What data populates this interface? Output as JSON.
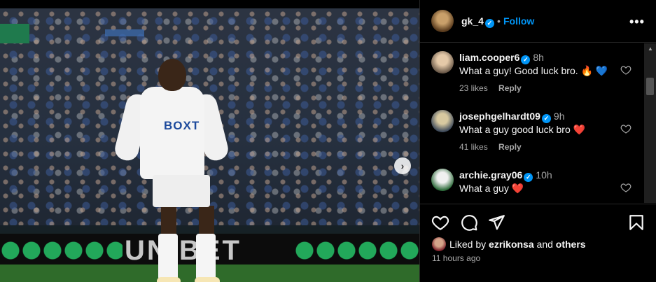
{
  "post": {
    "photo_sponsor": "BOXT",
    "board_text": "UNIBET"
  },
  "header": {
    "username": "gk_4",
    "separator": "•",
    "follow_label": "Follow"
  },
  "comments": [
    {
      "username": "liam.cooper6",
      "time": "8h",
      "text": "What a guy! Good luck bro.",
      "emoji": [
        "🔥",
        "💙"
      ],
      "likes": "23 likes",
      "reply": "Reply"
    },
    {
      "username": "josephgelhardt09",
      "time": "9h",
      "text": "What a guy good luck bro",
      "emoji": [
        "❤️"
      ],
      "likes": "41 likes",
      "reply": "Reply"
    },
    {
      "username": "archie.gray06",
      "time": "10h",
      "text": "What a guy",
      "emoji": [
        "❤️"
      ],
      "likes": "",
      "reply": ""
    }
  ],
  "actions": {
    "liked_prefix": "Liked by",
    "liked_user": "ezrikonsa",
    "liked_and": "and",
    "liked_others": "others",
    "time_ago": "11 hours ago"
  },
  "colors": {
    "accent": "#0095f6",
    "background": "#000000",
    "muted_text": "#a8a8a8"
  },
  "icons": [
    "more-icon",
    "verified-icon",
    "heart-icon",
    "comment-icon",
    "share-icon",
    "bookmark-icon",
    "chevron-right-icon"
  ]
}
